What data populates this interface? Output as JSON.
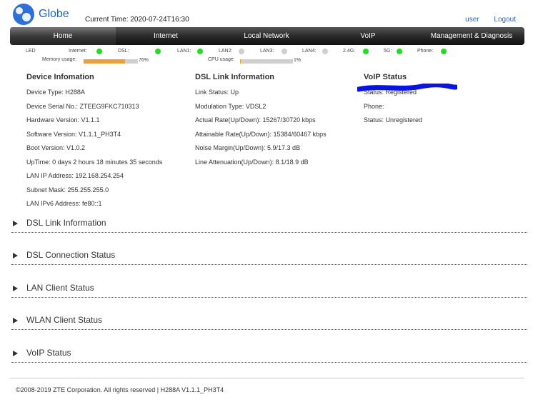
{
  "header": {
    "brand": "Globe",
    "current_time": "Current Time: 2020-07-24T16:30",
    "user_link": "user",
    "logout_link": "Logout"
  },
  "nav": [
    "Home",
    "Internet",
    "Local Network",
    "VoIP",
    "Management & Diagnosis"
  ],
  "leds": {
    "led_label": "LED",
    "items": [
      {
        "label": "Internet:",
        "state": "on"
      },
      {
        "label": "DSL:",
        "state": "on"
      },
      {
        "label": "LAN1:",
        "state": "on"
      },
      {
        "label": "LAN2:",
        "state": "off"
      },
      {
        "label": "LAN3:",
        "state": "off"
      },
      {
        "label": "LAN4:",
        "state": "off"
      },
      {
        "label": "2.4G:",
        "state": "on"
      },
      {
        "label": "5G:",
        "state": "on"
      },
      {
        "label": "Phone:",
        "state": "on"
      }
    ]
  },
  "usage": {
    "memory_label": "Memory usage:",
    "memory_pct": "76%",
    "memory_value": 0.76,
    "cpu_label": "CPU usage:",
    "cpu_pct": "1%",
    "cpu_value": 0.01
  },
  "device_info": {
    "title": "Device Infomation",
    "rows": [
      "Device Type: H288A",
      "Device Serial No.: ZTEEG9FKC710313",
      "Hardware Version: V1.1.1",
      "Software Version: V1.1.1_PH3T4",
      "Boot Version: V1.0.2",
      "UpTime: 0 days 2 hours 18 minutes 35 seconds",
      "LAN IP Address: 192.168.254.254",
      "Subnet Mask: 255.255.255.0",
      "LAN IPv6 Address: fe80::1"
    ]
  },
  "dsl_info": {
    "title": "DSL Link Information",
    "rows": [
      "Link Status: Up",
      "Modulation Type: VDSL2",
      "Actual Rate(Up/Down): 15267/30720 kbps",
      "Attainable Rate(Up/Down): 15384/60467 kbps",
      "Noise Margin(Up/Down): 5.9/17.3 dB",
      "Line Attenuation(Up/Down): 8.1/18.9 dB"
    ]
  },
  "voip_info": {
    "title": "VoIP Status",
    "redaction_color": "#0a14e0",
    "rows": [
      "Status: Registered",
      "Phone:",
      "Status: Unregistered"
    ]
  },
  "sections": [
    "DSL Link Information",
    "DSL Connection Status",
    "LAN Client Status",
    "WLAN Client Status",
    "VoIP Status"
  ],
  "footer": "©2008-2019 ZTE Corporation. All rights reserved  |   H288A V1.1.1_PH3T4"
}
